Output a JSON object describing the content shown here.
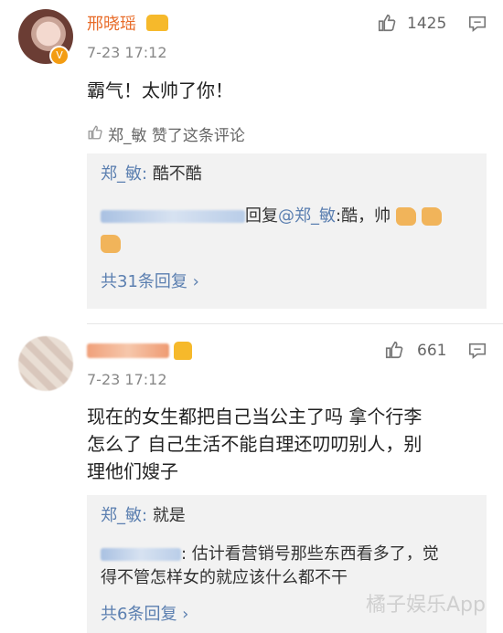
{
  "comments": [
    {
      "username": "邢晓瑶",
      "timestamp": "7-23 17:12",
      "likes": "1425",
      "text": "霸气！太帅了你！",
      "liked_by_text": "郑_敏 赞了这条评论",
      "replies": {
        "reply1_author": "郑_敏:",
        "reply1_text": "酷不酷",
        "reply2_prefix": "回复",
        "reply2_mention": "@郑_敏",
        "reply2_text": ":酷，帅",
        "more": "共31条回复 ›"
      }
    },
    {
      "timestamp": "7-23 17:12",
      "likes": "661",
      "text_line1": "现在的女生都把自己当公主了吗 拿个行李",
      "text_line2": "怎么了 自己生活不能自理还叨叨别人，别",
      "text_line3": "理他们嫂子",
      "replies": {
        "reply1_author": "郑_敏:",
        "reply1_text": "就是",
        "reply2_text_line1": ": 估计看营销号那些东西看多了，觉",
        "reply2_text_line2": "得不管怎样女的就应该什么都不干",
        "more": "共6条回复 ›"
      }
    }
  ],
  "watermark": "橘子娱乐App",
  "colors": {
    "name": "#e86b28",
    "link": "#5b7fb0",
    "time": "#888888"
  },
  "icons": [
    "thumb-up-icon",
    "comment-icon",
    "verified-badge-icon",
    "crown-badge-icon"
  ]
}
